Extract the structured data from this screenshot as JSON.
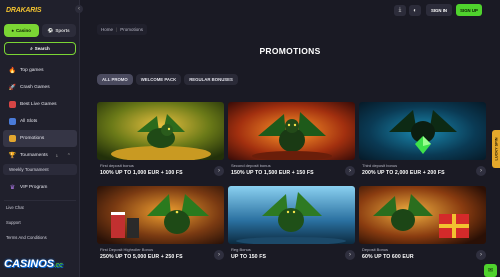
{
  "brand": {
    "logo_text": "DRAKARIS",
    "accent": "#7bd534"
  },
  "sidebar": {
    "casino_label": "Casino",
    "sports_label": "Sports",
    "search_label": "Search",
    "items": [
      {
        "label": "Top games",
        "icon": "flame-icon"
      },
      {
        "label": "Crash Games",
        "icon": "rocket-icon"
      },
      {
        "label": "Best Live Games",
        "icon": "live-icon"
      },
      {
        "label": "All Slots",
        "icon": "slots-icon"
      },
      {
        "label": "Promotions",
        "icon": "gift-icon"
      },
      {
        "label": "Tournaments",
        "icon": "trophy-icon",
        "badge": "1"
      }
    ],
    "weekly_label": "Weekly Tournament",
    "vip_label": "VIP Program",
    "footer": [
      "Live Chat",
      "Support",
      "Terms And Conditions"
    ]
  },
  "topbar": {
    "signin_label": "SIGN IN",
    "signup_label": "SIGN UP"
  },
  "breadcrumb": {
    "home": "Home",
    "current": "Promotions"
  },
  "page_title": "PROMOTIONS",
  "tabs": [
    "ALL PROMO",
    "WELCOME PACK",
    "REGULAR BONUSES"
  ],
  "cards": [
    {
      "sub": "First deposit bonus",
      "title": "100% UP TO 1,000 EUR + 100 FS"
    },
    {
      "sub": "Second deposit bonus",
      "title": "150% UP TO 1,500 EUR + 150 FS"
    },
    {
      "sub": "Third deposit bonus",
      "title": "200% UP TO 2,000 EUR + 200 FS"
    },
    {
      "sub": "First Deposit Highroller Bonus",
      "title": "250% UP TO 5,000 EUR + 250 FS"
    },
    {
      "sub": "Reg Bonus",
      "title": "UP TO 150 FS"
    },
    {
      "sub": "Deposit Bonus",
      "title": "60% UP TO 600 EUR"
    }
  ],
  "lucky_label": "LUCKY SPIN",
  "watermark": {
    "text": "CASINOS",
    "suffix": ".CC"
  }
}
